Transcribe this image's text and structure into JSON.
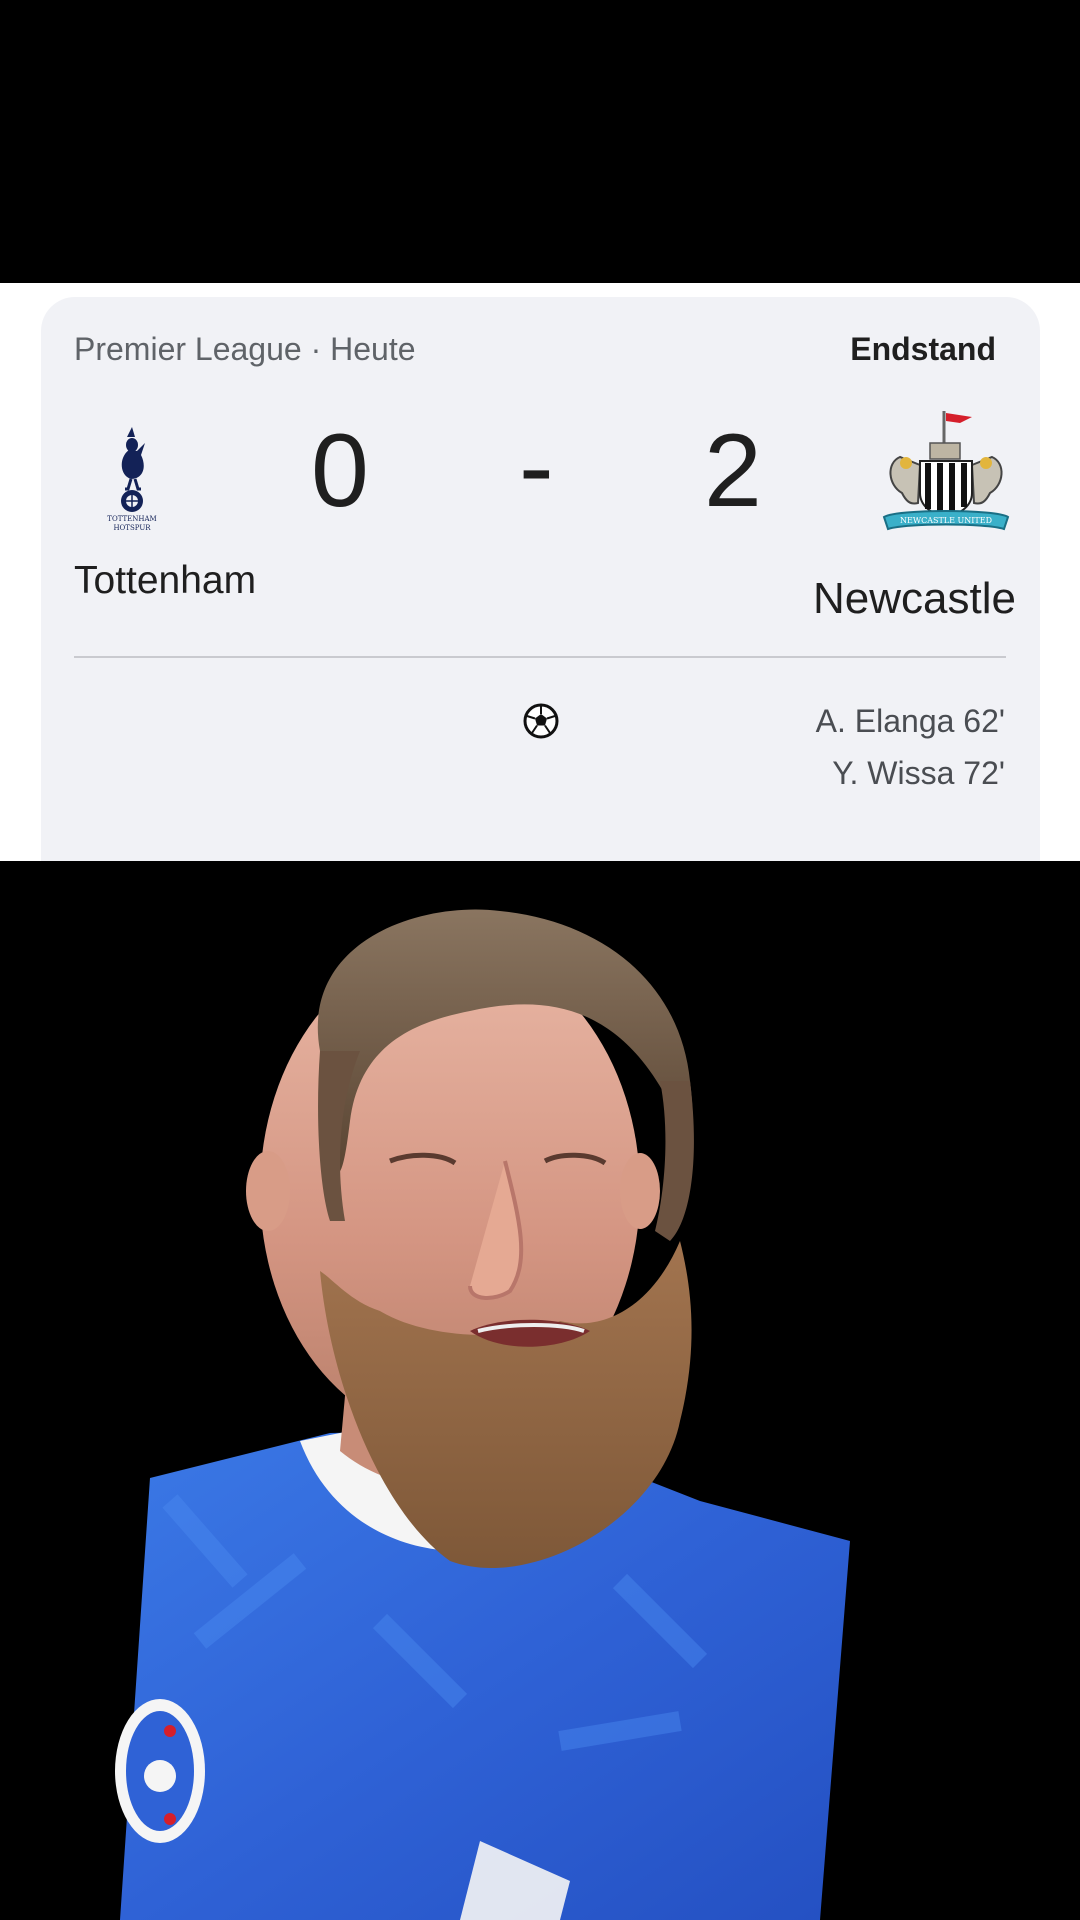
{
  "match_card": {
    "competition": "Premier League · Heute",
    "status": "Endstand",
    "home_team": {
      "name": "Tottenham",
      "score": "0",
      "crest_icon": "tottenham-crest-icon",
      "crest_text": "TOTTENHAM HOTSPUR"
    },
    "separator": "-",
    "away_team": {
      "name": "Newcastle",
      "score": "2",
      "crest_icon": "newcastle-crest-icon",
      "crest_text": "NEWCASTLE UNITED"
    },
    "goal_icon": "soccer-ball-icon",
    "away_scorers": [
      "A. Elanga 62'",
      "Y. Wissa 72'"
    ]
  },
  "colors": {
    "card_background": "#f1f2f6",
    "page_background": "#000000",
    "text_primary": "#1f1f1f",
    "text_secondary": "#5f6368",
    "jersey_blue": "#2f62d6"
  }
}
